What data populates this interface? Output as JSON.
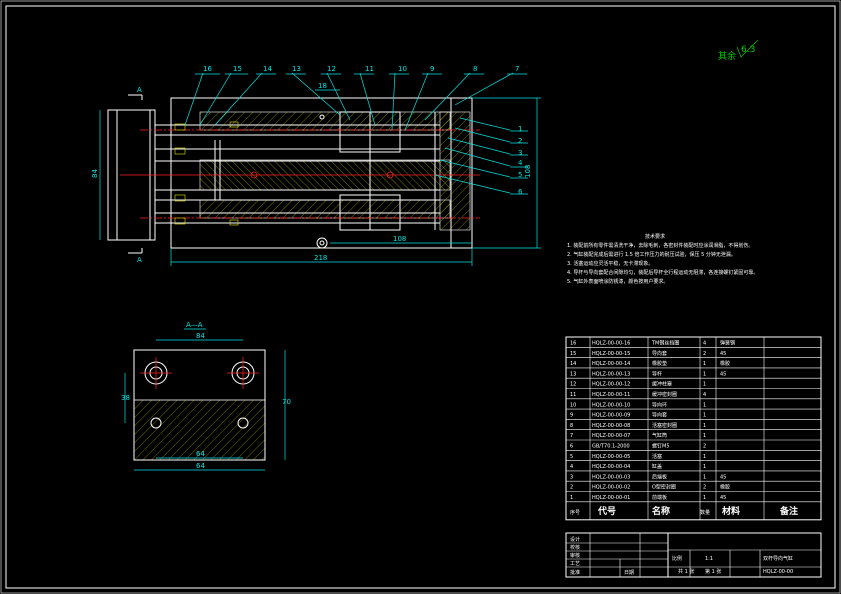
{
  "roughness": {
    "label": "其余",
    "value": "6.3"
  },
  "section_label": "A—A",
  "section_marker": "A",
  "balloons": [
    "16",
    "15",
    "14",
    "13",
    "12",
    "11",
    "10",
    "9",
    "8",
    "7"
  ],
  "side_balloons": [
    "1",
    "2",
    "3",
    "4",
    "5",
    "6"
  ],
  "dims": {
    "overall_length": "218",
    "inner_length": "108",
    "height_right": "108",
    "top_small": "18",
    "left_height": "84",
    "section_width": "84",
    "section_height": "70",
    "section_left": "38",
    "section_bottom1": "64",
    "section_bottom2": "64"
  },
  "tech_notes": {
    "title": "技术要求",
    "lines": [
      "1. 装配前所有零件需清洗干净，去除毛刺，各密封件装配时应涂润滑脂，不得划伤。",
      "2. 气缸装配完成后需进行 1.5 倍工作压力的耐压试验，保压 5 分钟无泄漏。",
      "3. 活塞运动应灵活平稳，无卡滞现象。",
      "4. 导杆与导向套配合间隙均匀，装配后导杆全行程运动无阻滞，各连接螺钉紧固可靠。",
      "5. 气缸外表面喷涂防锈漆，颜色按用户要求。"
    ]
  },
  "bom": {
    "headers": [
      "序号",
      "代号",
      "名称",
      "数量",
      "材料",
      "备注"
    ],
    "rows": [
      [
        "16",
        "HQLZ-00-00-16",
        "TM钢丝挡圈",
        "4",
        "弹簧钢",
        ""
      ],
      [
        "15",
        "HQLZ-00-00-15",
        "导向套",
        "2",
        "45",
        ""
      ],
      [
        "14",
        "HQLZ-00-00-14",
        "橡胶垫",
        "1",
        "橡胶",
        ""
      ],
      [
        "13",
        "HQLZ-00-00-13",
        "导杆",
        "1",
        "45",
        ""
      ],
      [
        "12",
        "HQLZ-00-00-12",
        "缓冲柱塞",
        "1",
        "",
        ""
      ],
      [
        "11",
        "HQLZ-00-00-11",
        "缓冲密封圈",
        "4",
        "",
        ""
      ],
      [
        "10",
        "HQLZ-00-00-10",
        "导向环",
        "1",
        "",
        ""
      ],
      [
        "9",
        "HQLZ-00-00-09",
        "导向套",
        "1",
        "",
        ""
      ],
      [
        "8",
        "HQLZ-00-00-08",
        "活塞密封圈",
        "1",
        "",
        ""
      ],
      [
        "7",
        "HQLZ-00-00-07",
        "气缸筒",
        "1",
        "",
        ""
      ],
      [
        "6",
        "GB/T70.1-2000",
        "螺钉M5",
        "2",
        "",
        ""
      ],
      [
        "5",
        "HQLZ-00-00-05",
        "活塞",
        "1",
        "",
        ""
      ],
      [
        "4",
        "HQLZ-00-00-04",
        "缸盖",
        "1",
        "",
        ""
      ],
      [
        "3",
        "HQLZ-00-00-03",
        "后端板",
        "1",
        "45",
        ""
      ],
      [
        "2",
        "HQLZ-00-00-02",
        "O型密封圈",
        "2",
        "橡胶",
        ""
      ],
      [
        "1",
        "HQLZ-00-00-01",
        "前端板",
        "1",
        "45",
        ""
      ]
    ]
  },
  "title_block": {
    "labels": [
      "设计",
      "校核",
      "审核",
      "工艺",
      "标准化",
      "批准"
    ],
    "scale_label": "比例",
    "scale": "1:1",
    "name": "双杆导向气缸",
    "code": "HQLZ-00-00",
    "sheets": "共 1 张",
    "sheet_no": "第 1 张",
    "date_label": "日期"
  }
}
